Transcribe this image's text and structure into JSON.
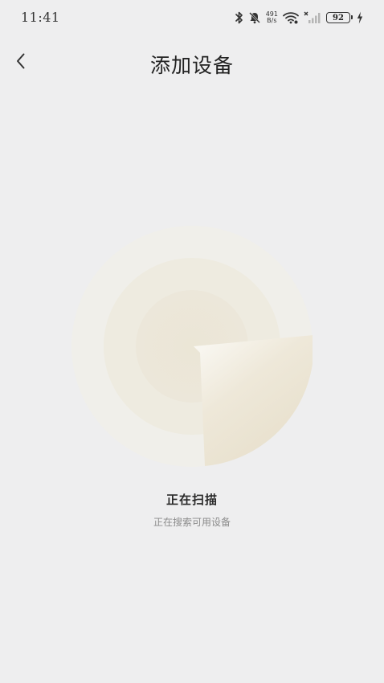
{
  "status_bar": {
    "time": "11:41",
    "net_speed_value": "491",
    "net_speed_unit": "B/s",
    "battery": "92",
    "icons": [
      "bluetooth-icon",
      "mute-bell-icon",
      "wifi-icon",
      "no-signal-icon",
      "battery-icon",
      "charging-icon"
    ]
  },
  "header": {
    "title": "添加设备",
    "back_icon": "chevron-left-icon"
  },
  "scan": {
    "title": "正在扫描",
    "subtitle": "正在搜索可用设备"
  },
  "colors": {
    "background": "#eeeeef",
    "radar_outer": "#f0efea",
    "radar_middle": "#eeebe0",
    "radar_inner": "#ece6d8",
    "sweep": "#e9e2cf"
  }
}
